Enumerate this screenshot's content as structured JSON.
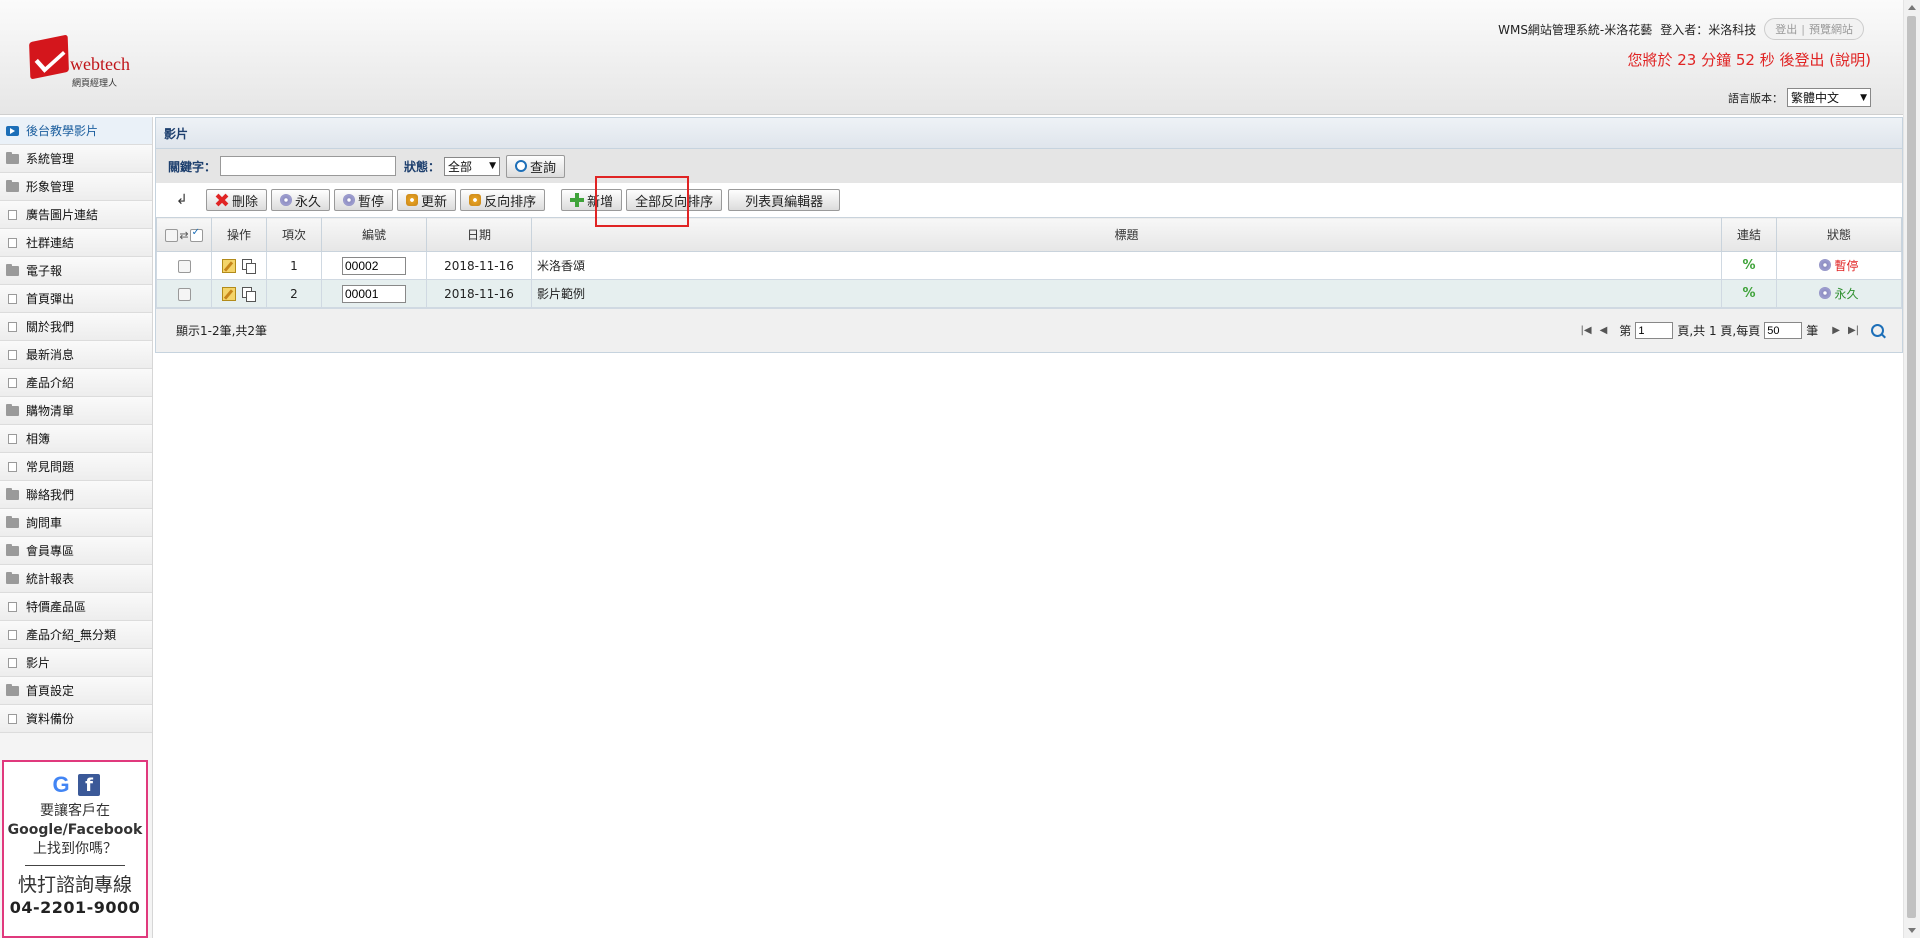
{
  "header": {
    "logo_text": "webtech",
    "logo_sub": "網頁經理人",
    "system_title": "WMS網站管理系統-米洛花藝",
    "login_label": "登入者：米洛科技",
    "logout_label": "登出",
    "preview_label": "預覽網站",
    "countdown": "您將於 23 分鐘 52 秒 後登出 (說明)",
    "lang_label": "語言版本：",
    "lang_value": "繁體中文"
  },
  "sidebar": {
    "items": [
      {
        "label": "後台教學影片",
        "icon": "video-icon"
      },
      {
        "label": "系統管理",
        "icon": "folder-icon"
      },
      {
        "label": "形象管理",
        "icon": "folder-icon"
      },
      {
        "label": "廣告圖片連結",
        "icon": "page-icon"
      },
      {
        "label": "社群連結",
        "icon": "page-icon"
      },
      {
        "label": "電子報",
        "icon": "folder-icon"
      },
      {
        "label": "首頁彈出",
        "icon": "page-icon"
      },
      {
        "label": "關於我們",
        "icon": "page-icon"
      },
      {
        "label": "最新消息",
        "icon": "page-icon"
      },
      {
        "label": "產品介紹",
        "icon": "page-icon"
      },
      {
        "label": "購物清單",
        "icon": "folder-icon"
      },
      {
        "label": "相簿",
        "icon": "page-icon"
      },
      {
        "label": "常見問題",
        "icon": "page-icon"
      },
      {
        "label": "聯絡我們",
        "icon": "folder-icon"
      },
      {
        "label": "詢問車",
        "icon": "folder-icon"
      },
      {
        "label": "會員專區",
        "icon": "folder-icon"
      },
      {
        "label": "統計報表",
        "icon": "folder-icon"
      },
      {
        "label": "特價產品區",
        "icon": "page-icon"
      },
      {
        "label": "產品介紹_無分類",
        "icon": "page-icon"
      },
      {
        "label": "影片",
        "icon": "page-icon"
      },
      {
        "label": "首頁設定",
        "icon": "folder-icon"
      },
      {
        "label": "資料備份",
        "icon": "page-icon"
      }
    ],
    "promo": {
      "line1": "要讓客戶在",
      "line2": "Google/Facebook",
      "line3": "上找到你嗎？",
      "line4": "快打諮詢專線",
      "phone": "04-2201-9000"
    }
  },
  "main": {
    "panel_title": "影片",
    "search": {
      "keyword_label": "關鍵字：",
      "keyword_value": "",
      "status_label": "狀態：",
      "status_value": "全部",
      "query_button": "查詢"
    },
    "toolbar": {
      "delete": "刪除",
      "permanent": "永久",
      "pause": "暫停",
      "update": "更新",
      "reverse_sort": "反向排序",
      "add": "新增",
      "reverse_all": "全部反向排序",
      "list_editor": "列表頁編輯器"
    },
    "table": {
      "headers": [
        "操作",
        "項次",
        "編號",
        "日期",
        "標題",
        "連結",
        "狀態"
      ],
      "rows": [
        {
          "index": "1",
          "code": "00002",
          "date": "2018-11-16",
          "title": "米洛香頌",
          "status": "暫停"
        },
        {
          "index": "2",
          "code": "00001",
          "date": "2018-11-16",
          "title": "影片範例",
          "status": "永久"
        }
      ]
    },
    "footer": {
      "summary": "顯示1-2筆,共2筆",
      "page_prefix": "第",
      "page_value": "1",
      "page_mid": "頁,共 1 頁,每頁",
      "per_page_value": "50",
      "per_page_suffix": "筆"
    }
  },
  "colors": {
    "accent": "#e02424",
    "link": "#1d6fb8",
    "highlight_box": "#e02424"
  }
}
